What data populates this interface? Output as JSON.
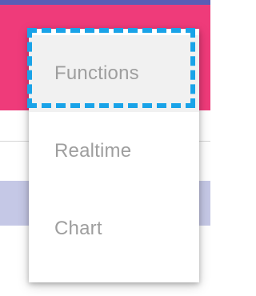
{
  "menu": {
    "items": [
      {
        "label": "Functions",
        "selected": true
      },
      {
        "label": "Realtime",
        "selected": false
      },
      {
        "label": "Chart",
        "selected": false
      }
    ]
  },
  "colors": {
    "header": "#ef3b7a",
    "header_accent": "#5a5db5",
    "strip": "#c5c8e6",
    "menu_text": "#9e9e9e",
    "selected_bg": "#f1f1f1",
    "focus_outline": "#1aa3e8"
  }
}
